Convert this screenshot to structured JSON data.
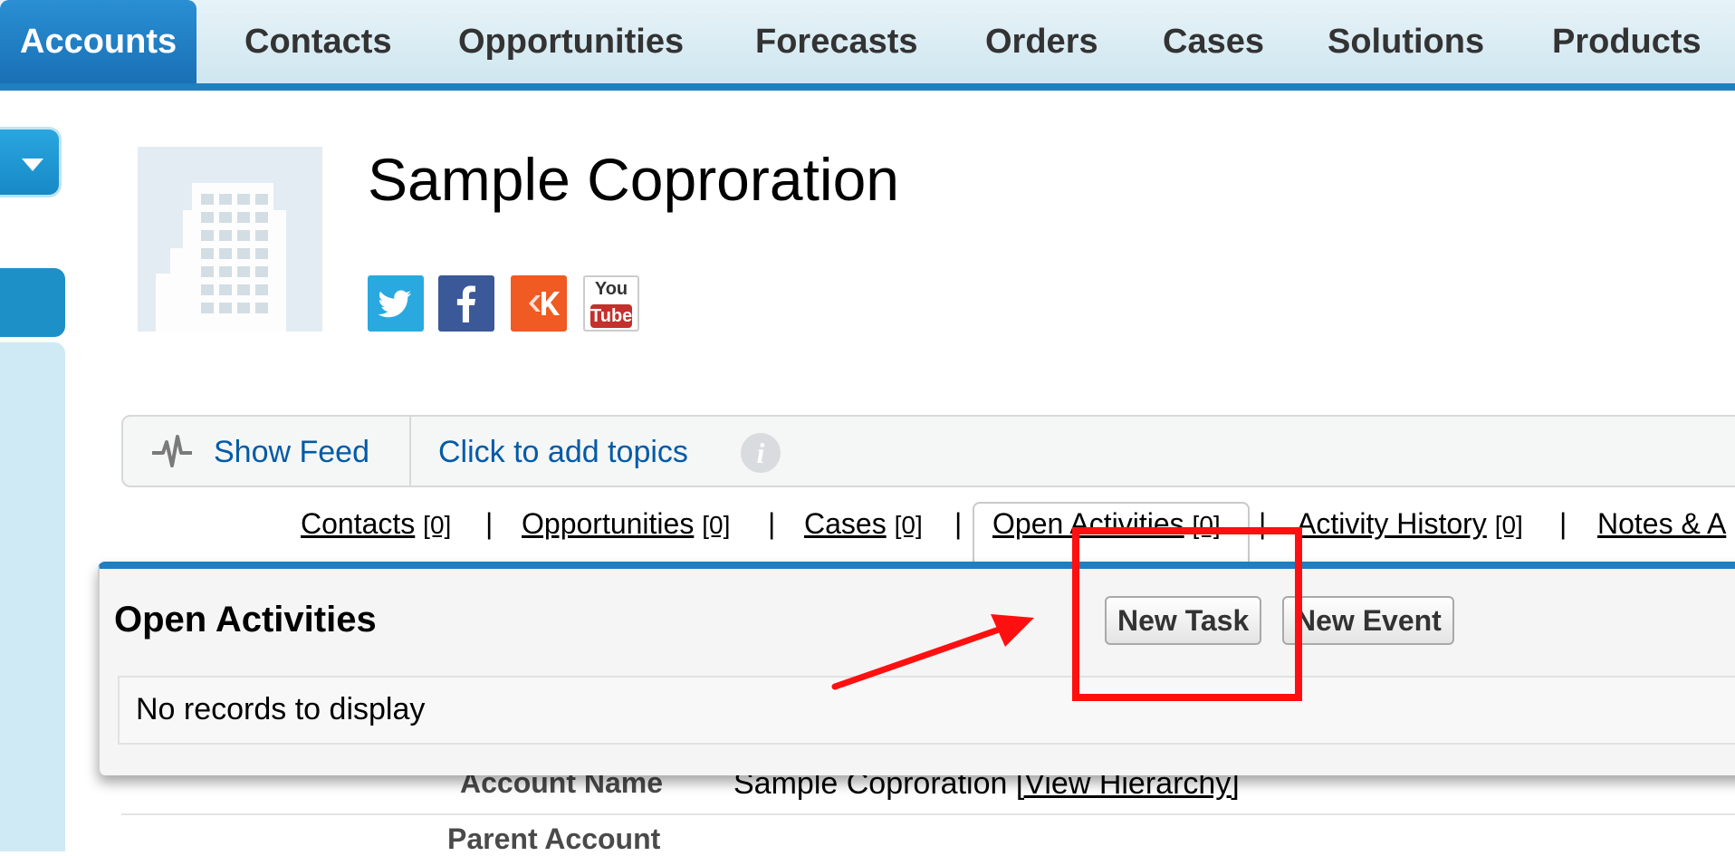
{
  "topnav": {
    "tabs": [
      {
        "label": "Accounts",
        "active": true
      },
      {
        "label": "Contacts"
      },
      {
        "label": "Opportunities"
      },
      {
        "label": "Forecasts"
      },
      {
        "label": "Orders"
      },
      {
        "label": "Cases"
      },
      {
        "label": "Solutions"
      },
      {
        "label": "Products"
      }
    ],
    "accent_color": "#1f7fc1"
  },
  "header": {
    "title": "Sample Coproration",
    "social_icons": [
      "twitter-icon",
      "facebook-icon",
      "klout-icon",
      "youtube-icon"
    ],
    "youtube_top": "You",
    "youtube_bottom": "Tube"
  },
  "feedbar": {
    "show_feed": "Show Feed",
    "add_topics": "Click to add topics",
    "info": "i"
  },
  "related_links": [
    {
      "name": "Contacts",
      "count": "[0]"
    },
    {
      "name": "Opportunities",
      "count": "[0]"
    },
    {
      "name": "Cases",
      "count": "[0]"
    },
    {
      "name": "Open Activities",
      "count": "[0]"
    },
    {
      "name": "Activity History",
      "count": "[0]"
    },
    {
      "name": "Notes & A",
      "count": ""
    }
  ],
  "separator": "|",
  "open_activities": {
    "title": "Open Activities",
    "new_task": "New Task",
    "new_event": "New Event",
    "empty": "No records to display"
  },
  "details": {
    "account_name_label": "Account Name",
    "account_name_value": "Sample Coproration",
    "view_hierarchy": "[View Hierarchy]",
    "parent_account_label": "Parent Account"
  }
}
